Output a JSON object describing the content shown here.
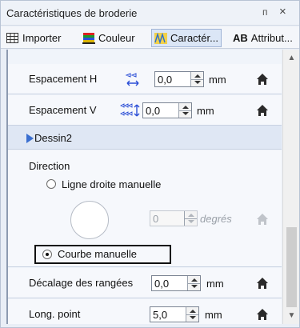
{
  "window": {
    "title": "Caractéristiques de broderie",
    "pin_glyph": "ᴨ",
    "close_glyph": "×"
  },
  "tabs": [
    {
      "label": "Importer",
      "icon": "grid-icon",
      "active": false
    },
    {
      "label": "Couleur",
      "icon": "color-stripes-icon",
      "active": false
    },
    {
      "label": "Caractér...",
      "icon": "stitch-pattern-icon",
      "active": true
    },
    {
      "label": "Attribut...",
      "icon": "ab-text-icon",
      "active": false,
      "prefix": "AB"
    }
  ],
  "rows": {
    "espacement_h": {
      "label": "Espacement H",
      "value": "0,0",
      "unit": "mm"
    },
    "espacement_v": {
      "label": "Espacement V",
      "value": "0,0",
      "unit": "mm"
    }
  },
  "section": {
    "name": "Dessin2"
  },
  "direction": {
    "label": "Direction",
    "option_manual_line": "Ligne droite manuelle",
    "angle_value": "0",
    "angle_unit": "degrés",
    "option_manual_curve": "Courbe manuelle",
    "selected": "manual_curve"
  },
  "rows2": {
    "decalage": {
      "label": "Décalage des rangées",
      "value": "0,0",
      "unit": "mm"
    },
    "long_point": {
      "label": "Long. point",
      "value": "5,0",
      "unit": "mm"
    }
  },
  "colors": {
    "accent": "#3a6fd0",
    "panel_bg": "#e9eef6"
  }
}
